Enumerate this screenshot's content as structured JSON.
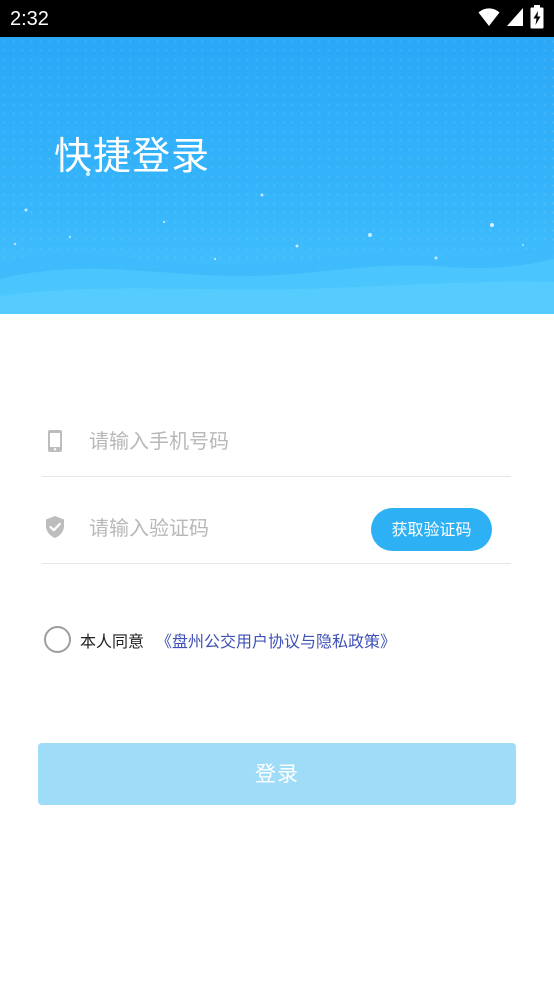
{
  "status_bar": {
    "time": "2:32",
    "icons": [
      "wifi-icon",
      "signal-icon",
      "battery-charging-icon"
    ]
  },
  "header": {
    "title": "快捷登录",
    "colors": {
      "gradient_top": "#2aa7f7",
      "gradient_bottom": "#46c3fd"
    }
  },
  "form": {
    "phone": {
      "placeholder": "请输入手机号码",
      "value": "",
      "icon": "phone-icon"
    },
    "code": {
      "placeholder": "请输入验证码",
      "value": "",
      "icon": "shield-check-icon"
    },
    "get_code_label": "获取验证码",
    "agree_label": "本人同意",
    "agreement_link": "《盘州公交用户协议与隐私政策》",
    "agree_checked": false,
    "login_label": "登录"
  },
  "colors": {
    "accent": "#2eb1f4",
    "link": "#3f51b5",
    "login_disabled": "#9fdcf8"
  }
}
